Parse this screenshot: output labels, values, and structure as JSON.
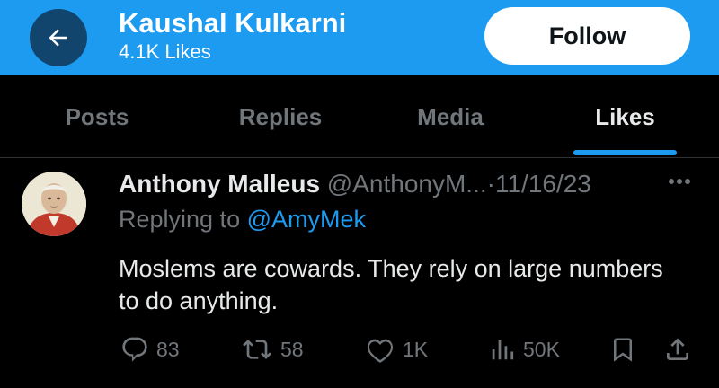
{
  "header": {
    "title": "Kaushal Kulkarni",
    "subtitle": "4.1K Likes",
    "follow_label": "Follow",
    "back_icon": "arrow-left-icon"
  },
  "tabs": [
    {
      "label": "Posts",
      "active": false
    },
    {
      "label": "Replies",
      "active": false
    },
    {
      "label": "Media",
      "active": false
    },
    {
      "label": "Likes",
      "active": true
    }
  ],
  "post": {
    "author_name": "Anthony Malleus",
    "author_handle": "@AnthonyM...",
    "separator": "·",
    "date": "11/16/23",
    "replying_prefix": "Replying to",
    "replying_to": "@AmyMek",
    "text": "Moslems are cowards. They rely on large numbers to do anything.",
    "actions": {
      "replies": "83",
      "reposts": "58",
      "likes": "1K",
      "views": "50K"
    }
  },
  "colors": {
    "accent": "#1d9bf0",
    "background": "#000000",
    "muted": "#71767b",
    "text": "#e7e9ea"
  }
}
